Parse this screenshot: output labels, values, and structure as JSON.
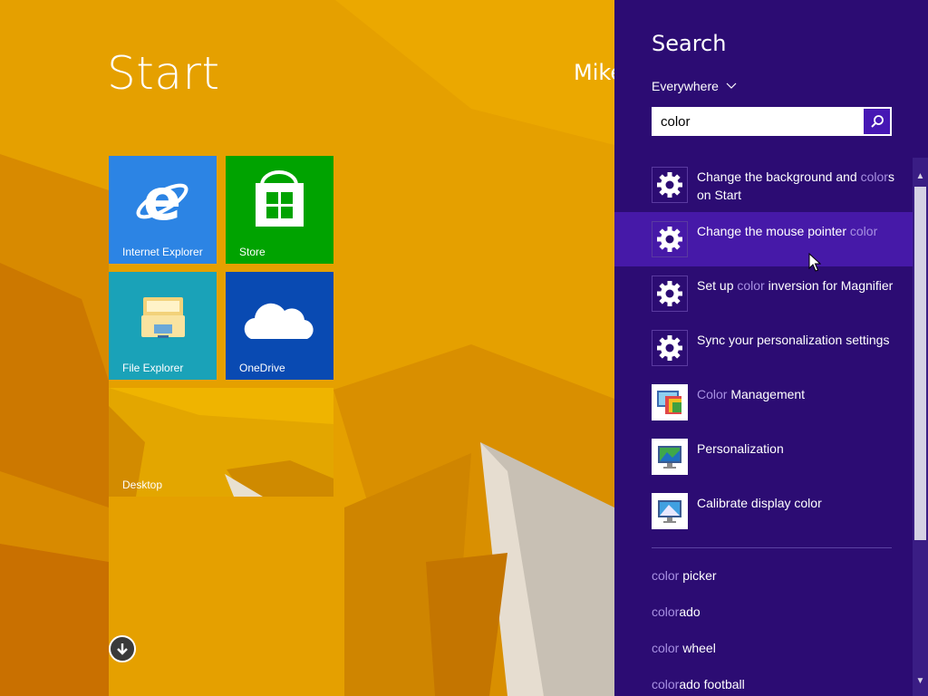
{
  "start": {
    "title": "Start",
    "user_name": "Mike"
  },
  "tiles": [
    {
      "label": "Internet Explorer",
      "icon": "internet-explorer-icon",
      "color": "#2c84e4"
    },
    {
      "label": "Store",
      "icon": "store-icon",
      "color": "#00a300"
    },
    {
      "label": "File Explorer",
      "icon": "file-explorer-icon",
      "color": "#1aa2b8"
    },
    {
      "label": "OneDrive",
      "icon": "onedrive-icon",
      "color": "#094ab2"
    },
    {
      "label": "Desktop",
      "icon": "desktop-wallpaper",
      "color": "#e0a200"
    }
  ],
  "search": {
    "heading": "Search",
    "scope": "Everywhere",
    "query": "color",
    "results": [
      {
        "icon": "settings-gear-icon",
        "parts": [
          [
            "Change the background and ",
            false
          ],
          [
            "color",
            true
          ],
          [
            "s on Start",
            false
          ]
        ]
      },
      {
        "icon": "settings-gear-icon",
        "parts": [
          [
            "Change the mouse pointer ",
            false
          ],
          [
            "color",
            true
          ]
        ]
      },
      {
        "icon": "settings-gear-icon",
        "parts": [
          [
            "Set up ",
            false
          ],
          [
            "color",
            true
          ],
          [
            " inversion for Magnifier",
            false
          ]
        ]
      },
      {
        "icon": "settings-gear-icon",
        "parts": [
          [
            "Sync your personalization settings",
            false
          ]
        ]
      },
      {
        "icon": "color-management-icon",
        "parts": [
          [
            "Color",
            true
          ],
          [
            " Management",
            false
          ]
        ]
      },
      {
        "icon": "personalization-icon",
        "parts": [
          [
            "Personalization",
            false
          ]
        ]
      },
      {
        "icon": "calibrate-display-icon",
        "parts": [
          [
            "Calibrate display color",
            false
          ]
        ]
      }
    ],
    "suggestions": [
      {
        "parts": [
          [
            "color",
            true
          ],
          [
            " picker",
            false
          ]
        ]
      },
      {
        "parts": [
          [
            "color",
            true
          ],
          [
            "ado",
            false
          ]
        ]
      },
      {
        "parts": [
          [
            "color",
            true
          ],
          [
            " wheel",
            false
          ]
        ]
      },
      {
        "parts": [
          [
            "color",
            true
          ],
          [
            "ado football",
            false
          ]
        ]
      }
    ]
  },
  "colors": {
    "pane": "#2c0c73",
    "hover": "#4619a8",
    "highlight": "#a790e2",
    "background": "#e8a400"
  }
}
